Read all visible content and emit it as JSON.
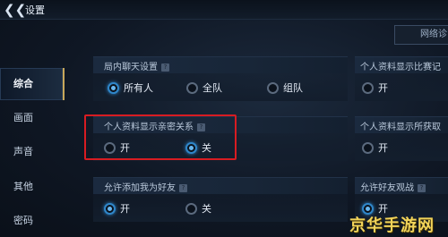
{
  "header": {
    "back_icon": "chevron-left-icon",
    "title": "设置",
    "network_button": "网络诊"
  },
  "sidebar": {
    "items": [
      {
        "label": "综合",
        "active": true
      },
      {
        "label": "画面",
        "active": false
      },
      {
        "label": "声音",
        "active": false
      },
      {
        "label": "其他",
        "active": false
      },
      {
        "label": "密码",
        "active": false
      }
    ]
  },
  "panels": {
    "chat": {
      "label": "局内聊天设置",
      "options": [
        "所有人",
        "全队",
        "组队"
      ],
      "selected": 0
    },
    "profile_compare": {
      "label": "个人资料显示比赛记",
      "options": [
        "开"
      ]
    },
    "intimacy": {
      "label": "个人资料显示亲密关系",
      "options": [
        "开",
        "关"
      ],
      "selected": 1
    },
    "profile_obtained": {
      "label": "个人资料显示所获取",
      "options": [
        "开"
      ]
    },
    "add_friend": {
      "label": "允许添加我为好友",
      "options": [
        "开",
        "关"
      ],
      "selected": 0
    },
    "friend_watch": {
      "label": "允许好友观战",
      "options": [
        "开"
      ],
      "selected": 0
    }
  },
  "watermark": "京华手游网",
  "colors": {
    "highlight": "#d81c22",
    "accent": "#2f86c9",
    "active_tab_border": "#c7a75a"
  }
}
